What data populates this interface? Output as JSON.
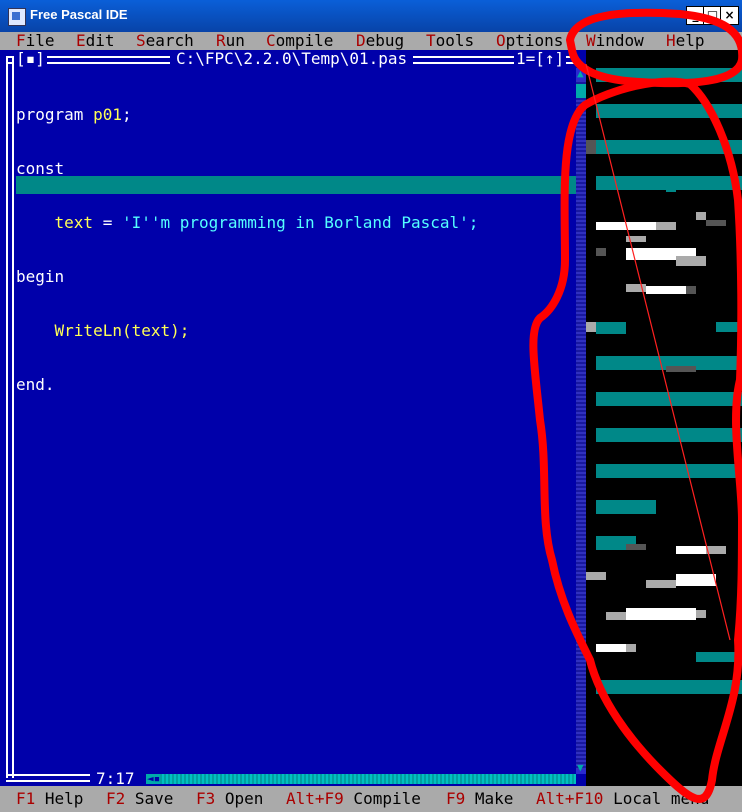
{
  "window": {
    "title": "Free Pascal IDE",
    "min_glyph": "_",
    "max_glyph": "□",
    "close_glyph": "×"
  },
  "menu": [
    {
      "hot": "F",
      "rest": "ile"
    },
    {
      "hot": "E",
      "rest": "dit"
    },
    {
      "hot": "S",
      "rest": "earch"
    },
    {
      "hot": "R",
      "rest": "un"
    },
    {
      "hot": "C",
      "rest": "ompile"
    },
    {
      "hot": "D",
      "rest": "ebug"
    },
    {
      "hot": "T",
      "rest": "ools"
    },
    {
      "hot": "O",
      "rest": "ptions"
    },
    {
      "hot": "W",
      "rest": "indow"
    },
    {
      "hot": "H",
      "rest": "elp"
    }
  ],
  "editor": {
    "close_box": "[▪]",
    "file_path": "C:\\FPC\\2.2.0\\Temp\\01.pas",
    "window_number": "1=[↑]",
    "cursor_position": "7:17",
    "code": [
      {
        "a": "program ",
        "b": "p01",
        "c": ";",
        "d": ""
      },
      {
        "a": "const",
        "b": "",
        "c": "",
        "d": ""
      },
      {
        "a": "    ",
        "b": "text",
        "c": " = ",
        "d": "'I''m programming in Borland Pascal';"
      },
      {
        "a": "begin",
        "b": "",
        "c": "",
        "d": ""
      },
      {
        "a": "    ",
        "b": "WriteLn(text);",
        "c": "",
        "d": ""
      },
      {
        "a": "end.",
        "b": "",
        "c": "",
        "d": ""
      }
    ]
  },
  "status": [
    {
      "key": "F1",
      "label": " Help"
    },
    {
      "key": "F2",
      "label": " Save"
    },
    {
      "key": "F3",
      "label": " Open"
    },
    {
      "key": "Alt+F9",
      "label": " Compile"
    },
    {
      "key": "F9",
      "label": " Make"
    },
    {
      "key": "Alt+F10",
      "label": " Local menu"
    }
  ],
  "colors": {
    "editor_bg": "#0000aa",
    "menu_bg": "#aaaaaa",
    "hotkey": "#aa0000",
    "identifier": "#ffff55",
    "string": "#55ffff",
    "annotation": "#ff0000"
  }
}
